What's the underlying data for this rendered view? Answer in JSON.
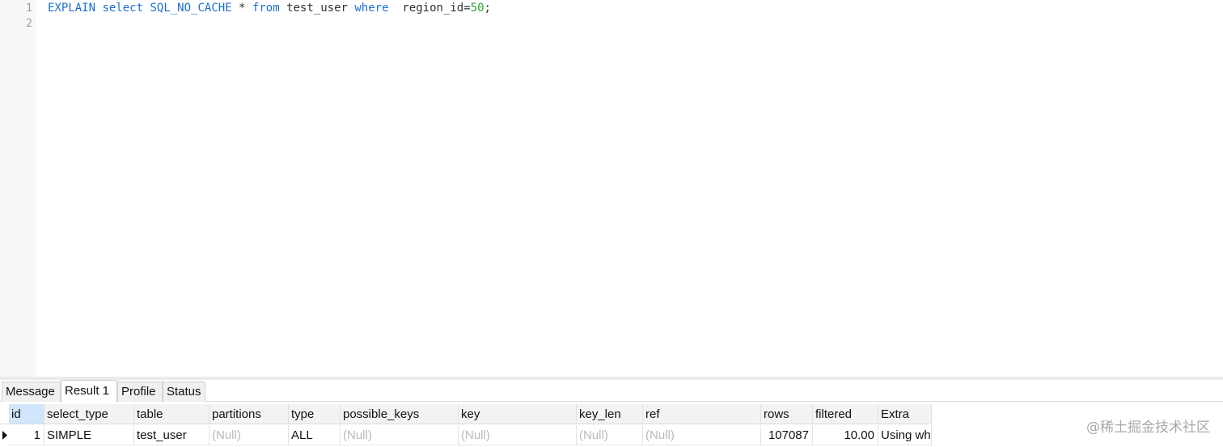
{
  "editor": {
    "line_numbers": [
      "1",
      "2"
    ],
    "line1": {
      "t1": "EXPLAIN",
      "t2": " ",
      "t3": "select",
      "t4": " ",
      "t5": "SQL_NO_CACHE",
      "t6": " * ",
      "t7": "from",
      "t8": " test_user ",
      "t9": "where",
      "t10": "  region_id=",
      "t11": "50",
      "t12": ";"
    }
  },
  "tabs": [
    {
      "label": "Message"
    },
    {
      "label": "Result 1",
      "active": true
    },
    {
      "label": "Profile"
    },
    {
      "label": "Status"
    }
  ],
  "grid": {
    "columns": [
      "id",
      "select_type",
      "table",
      "partitions",
      "type",
      "possible_keys",
      "key",
      "key_len",
      "ref",
      "rows",
      "filtered",
      "Extra"
    ],
    "rows": [
      [
        "1",
        "SIMPLE",
        "test_user",
        "(Null)",
        "ALL",
        "(Null)",
        "(Null)",
        "(Null)",
        "(Null)",
        "107087",
        "10.00",
        "Using wh"
      ]
    ]
  },
  "watermark": "@稀土掘金技术社区",
  "colors": {
    "keyword": "#1a6fd1",
    "number": "#2aa52a",
    "null_text": "#b9b9b9",
    "selected_header": "#cfe6fb"
  },
  "icons": {
    "row_indicator": "triangle-right-icon"
  }
}
